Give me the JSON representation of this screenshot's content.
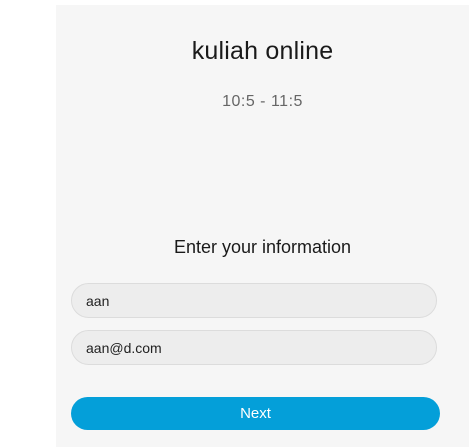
{
  "meeting": {
    "title": "kuliah online",
    "time": "10:5 - 11:5"
  },
  "form": {
    "heading": "Enter your information",
    "name_value": "aan",
    "email_value": "aan@d.com",
    "next_label": "Next"
  },
  "colors": {
    "panel_background": "#f6f6f6",
    "button_background": "#049fd9",
    "button_text": "#ffffff"
  }
}
